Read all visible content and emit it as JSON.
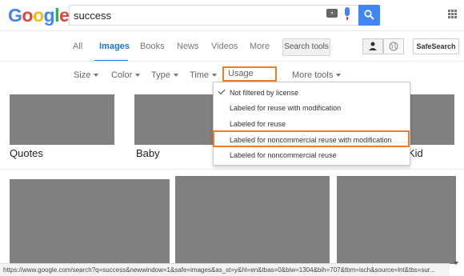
{
  "search": {
    "query": "success"
  },
  "nav": {
    "tabs": [
      "All",
      "Images",
      "Books",
      "News",
      "Videos",
      "More"
    ],
    "active": "Images",
    "search_tools": "Search tools",
    "safesearch": "SafeSearch"
  },
  "tools": {
    "size": "Size",
    "color": "Color",
    "type": "Type",
    "time": "Time",
    "usage_rights": "Usage rights",
    "more_tools": "More tools"
  },
  "dropdown": {
    "items": [
      "Not filtered by license",
      "Labeled for reuse with modification",
      "Labeled for reuse",
      "Labeled for noncommercial reuse with modification",
      "Labeled for noncommercial reuse"
    ],
    "selected_index": 0,
    "highlighted_index": 3
  },
  "images": {
    "captions": [
      "Quotes",
      "Baby",
      "Kid"
    ]
  },
  "status_url": "https://www.google.com/search?q=success&newwindow=1&safe=images&as_st=y&hl=en&tbas=0&biw=1304&bih=707&tbm=isch&source=lnt&tbs=sur...",
  "colors": {
    "accent": "#4285F4",
    "highlight": "#f07c2c",
    "placeholder_image": "#808080"
  }
}
